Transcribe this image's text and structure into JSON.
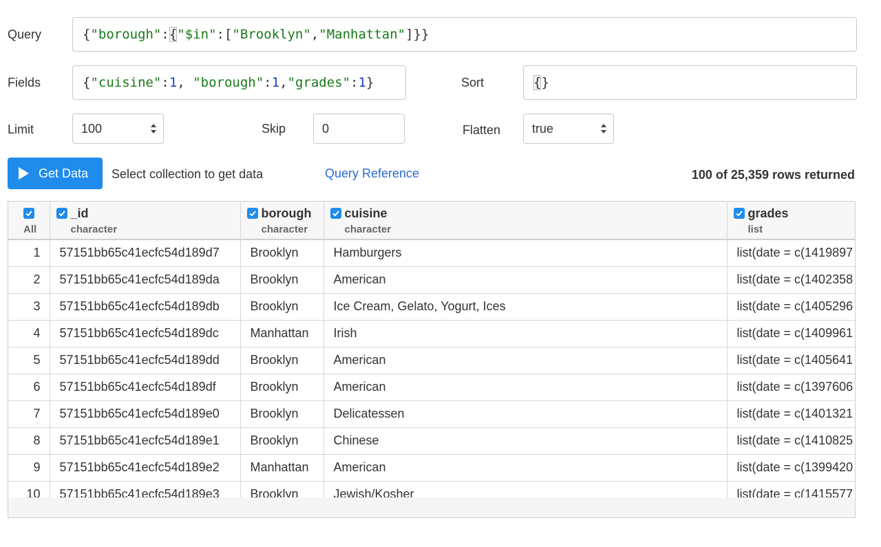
{
  "query": {
    "label": "Query",
    "tokens": [
      {
        "t": "{",
        "c": "br"
      },
      {
        "t": "\"borough\"",
        "c": "str"
      },
      {
        "t": ":",
        "c": "br"
      },
      {
        "t": "{",
        "c": "cur"
      },
      {
        "t": "\"$in\"",
        "c": "str"
      },
      {
        "t": ":[",
        "c": "br"
      },
      {
        "t": "\"Brooklyn\"",
        "c": "str"
      },
      {
        "t": ",",
        "c": "br"
      },
      {
        "t": "\"Manhattan\"",
        "c": "str"
      },
      {
        "t": "]}}",
        "c": "br"
      }
    ]
  },
  "fields": {
    "label": "Fields",
    "tokens": [
      {
        "t": "{",
        "c": "br"
      },
      {
        "t": "\"cuisine\"",
        "c": "str"
      },
      {
        "t": ":",
        "c": "br"
      },
      {
        "t": "1",
        "c": "num"
      },
      {
        "t": ", ",
        "c": "br"
      },
      {
        "t": "\"borough\"",
        "c": "str"
      },
      {
        "t": ":",
        "c": "br"
      },
      {
        "t": "1",
        "c": "num"
      },
      {
        "t": ",",
        "c": "br"
      },
      {
        "t": "\"grades\"",
        "c": "str"
      },
      {
        "t": ":",
        "c": "br"
      },
      {
        "t": "1",
        "c": "num"
      },
      {
        "t": "}",
        "c": "br"
      }
    ]
  },
  "sort": {
    "label": "Sort",
    "tokens": [
      {
        "t": "{",
        "c": "cur"
      },
      {
        "t": "}",
        "c": "br"
      }
    ]
  },
  "limit": {
    "label": "Limit",
    "value": "100"
  },
  "skip": {
    "label": "Skip",
    "value": "0"
  },
  "flatten": {
    "label": "Flatten",
    "value": "true"
  },
  "actions": {
    "get_data": "Get Data",
    "status": "Select collection to get data",
    "query_reference": "Query Reference",
    "rows_returned": "100 of 25,359 rows returned"
  },
  "colors": {
    "accent": "#1f8ceb",
    "link": "#2a6bd1",
    "string_token": "#1a7a1a",
    "number_token": "#1d3fc9"
  },
  "table": {
    "all_label": "All",
    "columns": [
      {
        "name": "_id",
        "type": "character"
      },
      {
        "name": "borough",
        "type": "character"
      },
      {
        "name": "cuisine",
        "type": "character"
      },
      {
        "name": "grades",
        "type": "list"
      }
    ],
    "rows": [
      {
        "n": "1",
        "id": "57151bb65c41ecfc54d189d7",
        "borough": "Brooklyn",
        "cuisine": "Hamburgers",
        "grades": "list(date = c(1419897"
      },
      {
        "n": "2",
        "id": "57151bb65c41ecfc54d189da",
        "borough": "Brooklyn",
        "cuisine": "American",
        "grades": "list(date = c(1402358"
      },
      {
        "n": "3",
        "id": "57151bb65c41ecfc54d189db",
        "borough": "Brooklyn",
        "cuisine": "Ice Cream, Gelato, Yogurt, Ices",
        "grades": "list(date = c(1405296"
      },
      {
        "n": "4",
        "id": "57151bb65c41ecfc54d189dc",
        "borough": "Manhattan",
        "cuisine": "Irish",
        "grades": "list(date = c(1409961"
      },
      {
        "n": "5",
        "id": "57151bb65c41ecfc54d189dd",
        "borough": "Brooklyn",
        "cuisine": "American",
        "grades": "list(date = c(1405641"
      },
      {
        "n": "6",
        "id": "57151bb65c41ecfc54d189df",
        "borough": "Brooklyn",
        "cuisine": "American",
        "grades": "list(date = c(1397606"
      },
      {
        "n": "7",
        "id": "57151bb65c41ecfc54d189e0",
        "borough": "Brooklyn",
        "cuisine": "Delicatessen",
        "grades": "list(date = c(1401321"
      },
      {
        "n": "8",
        "id": "57151bb65c41ecfc54d189e1",
        "borough": "Brooklyn",
        "cuisine": "Chinese",
        "grades": "list(date = c(1410825"
      },
      {
        "n": "9",
        "id": "57151bb65c41ecfc54d189e2",
        "borough": "Manhattan",
        "cuisine": "American",
        "grades": "list(date = c(1399420"
      },
      {
        "n": "10",
        "id": "57151bb65c41ecfc54d189e3",
        "borough": "Brooklyn",
        "cuisine": "Jewish/Kosher",
        "grades": "list(date = c(1415577"
      }
    ]
  }
}
